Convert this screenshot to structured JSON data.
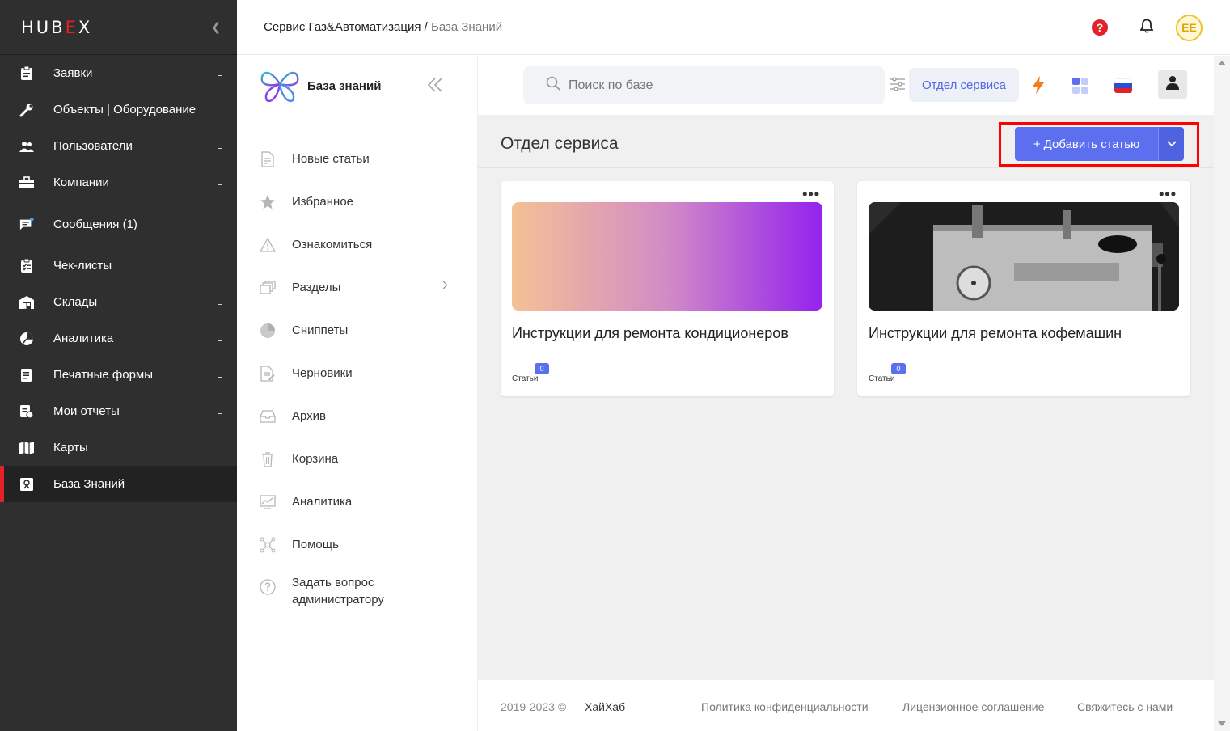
{
  "sidebar": {
    "logo_part1": "HUB",
    "logo_part2": "E",
    "logo_part3": "X",
    "items": [
      {
        "label": "Заявки",
        "icon": "clipboard-icon"
      },
      {
        "label": "Объекты | Оборудование",
        "icon": "wrench-icon"
      },
      {
        "label": "Пользователи",
        "icon": "users-icon"
      },
      {
        "label": "Компании",
        "icon": "briefcase-icon"
      },
      {
        "label": "Сообщения (1)",
        "icon": "chat-icon"
      },
      {
        "label": "Чек-листы",
        "icon": "checklist-icon"
      },
      {
        "label": "Склады",
        "icon": "warehouse-icon"
      },
      {
        "label": "Аналитика",
        "icon": "pie-chart-icon"
      },
      {
        "label": "Печатные формы",
        "icon": "print-form-icon"
      },
      {
        "label": "Мои отчеты",
        "icon": "reports-icon"
      },
      {
        "label": "Карты",
        "icon": "map-icon"
      },
      {
        "label": "База Знаний",
        "icon": "knowledge-icon"
      }
    ]
  },
  "header": {
    "breadcrumb_root": "Сервис Газ&Автоматизация",
    "breadcrumb_sep": " / ",
    "breadcrumb_current": "База Знаний",
    "avatar_initials": "EE"
  },
  "kb": {
    "title": "База знаний",
    "menu": [
      "Новые статьи",
      "Избранное",
      "Ознакомиться",
      "Разделы",
      "Сниппеты",
      "Черновики",
      "Архив",
      "Корзина",
      "Аналитика",
      "Помощь"
    ],
    "ask_line1": "Задать вопрос",
    "ask_line2": "администратору"
  },
  "main": {
    "search_placeholder": "Поиск по базе",
    "dept_button": "Отдел сервиса",
    "page_title": "Отдел сервиса",
    "add_button": "+  Добавить статью",
    "cards": [
      {
        "title": "Инструкции для ремонта кондиционеров",
        "count": "0",
        "count_label": "Статьи"
      },
      {
        "title": "Инструкции для ремонта кофемашин",
        "count": "0",
        "count_label": "Статьи"
      }
    ]
  },
  "footer": {
    "copyright": "2019-2023 ©",
    "brand": "ХайХаб",
    "privacy": "Политика конфиденциальности",
    "license": "Лицензионное соглашение",
    "contact": "Свяжитесь с нами"
  },
  "colors": {
    "accent": "#5b6fef",
    "brand_red": "#e3212b",
    "sidebar_bg": "#2f2f2f"
  }
}
